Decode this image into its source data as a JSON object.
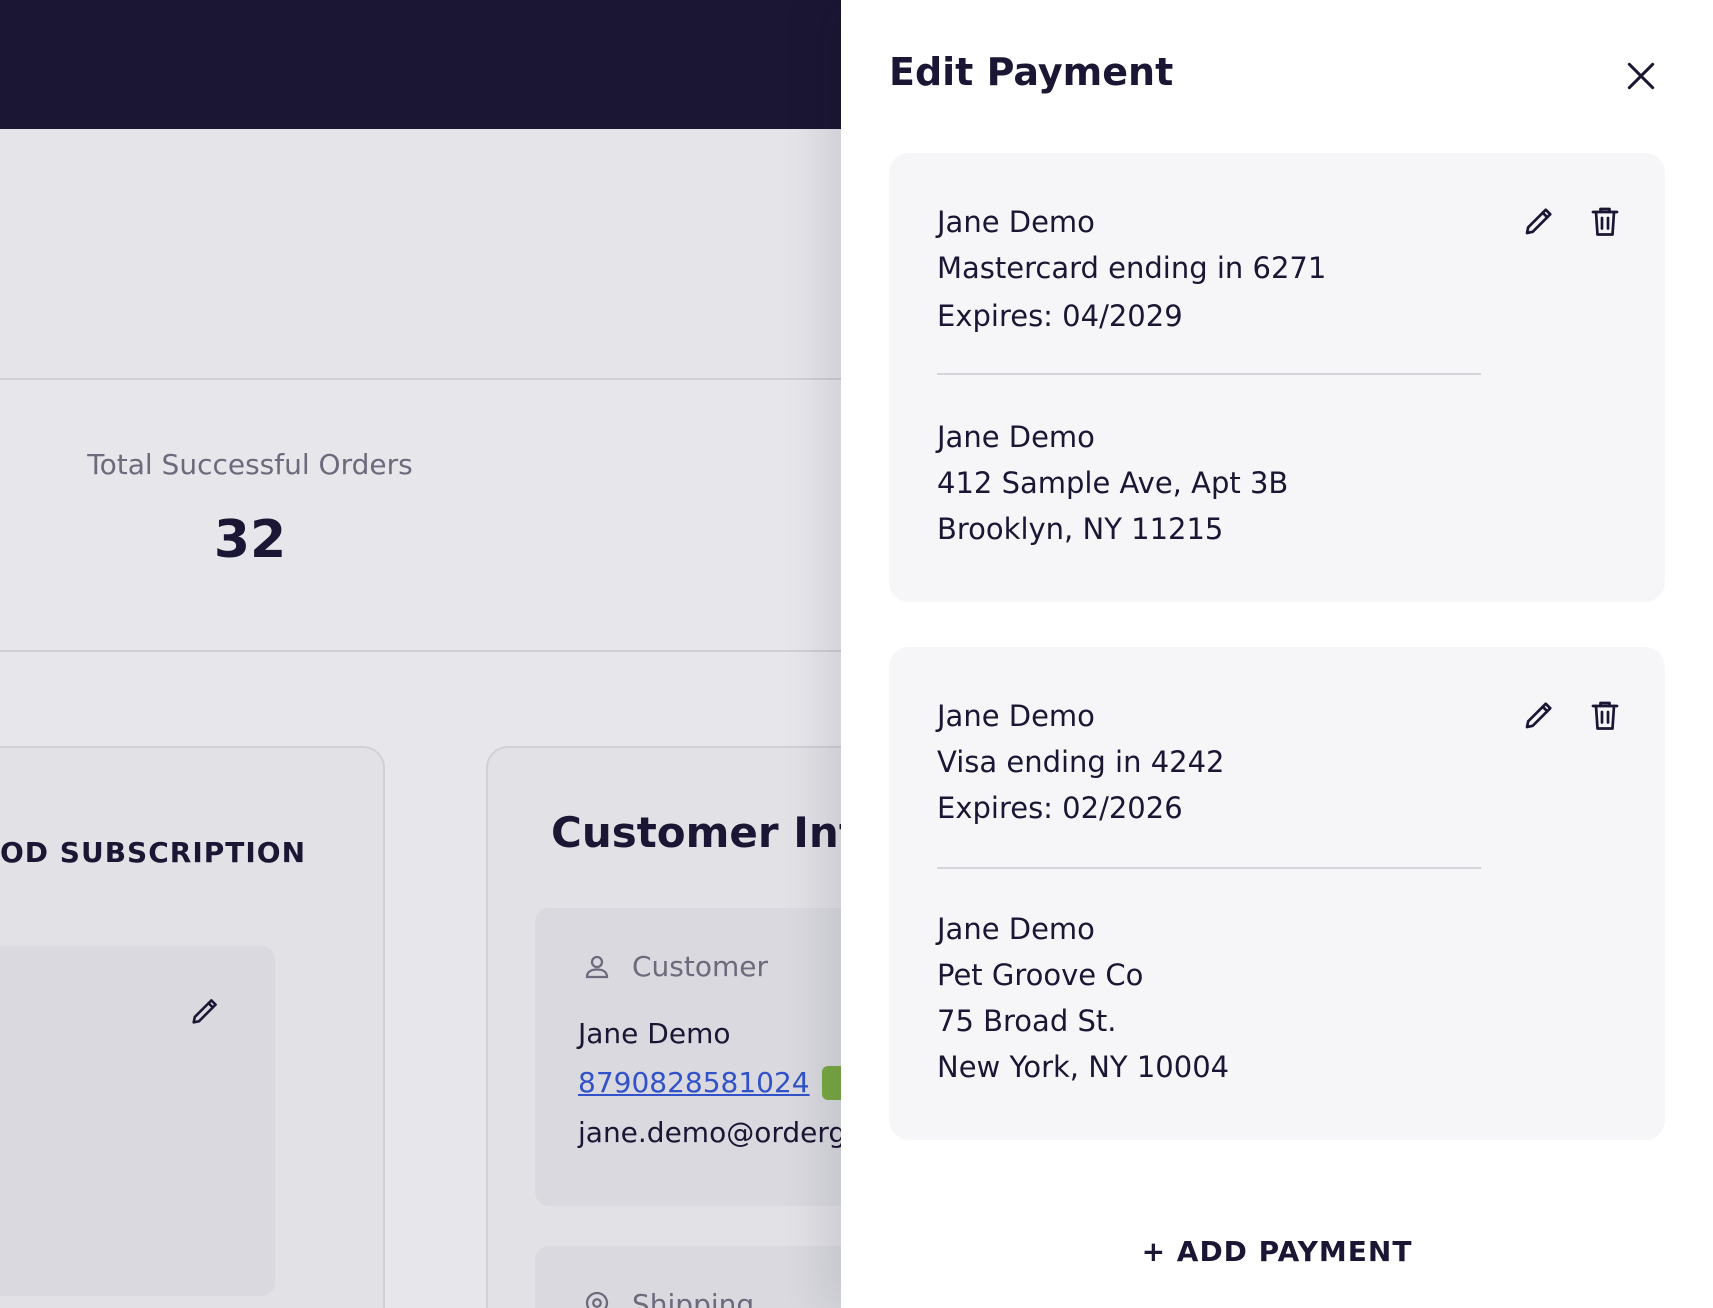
{
  "stats": {
    "total_orders_label": "Total Successful Orders",
    "total_orders_value": "32"
  },
  "subscription_card": {
    "title": "OD SUBSCRIPTION"
  },
  "customer_card": {
    "title": "Customer Info",
    "section_label": "Customer",
    "name": "Jane Demo",
    "phone": "8790828581024",
    "email": "jane.demo@ordergr",
    "shipping_label": "Shipping"
  },
  "drawer": {
    "title": "Edit Payment",
    "add_label": "+ ADD PAYMENT",
    "payments": [
      {
        "card_holder": "Jane Demo",
        "card_desc": "Mastercard ending in 6271",
        "expires": "Expires: 04/2029",
        "billing": [
          "Jane Demo",
          "412 Sample Ave, Apt 3B",
          "Brooklyn, NY 11215"
        ]
      },
      {
        "card_holder": "Jane Demo",
        "card_desc": "Visa ending in 4242",
        "expires": "Expires: 02/2026",
        "billing": [
          "Jane Demo",
          "Pet Groove Co",
          "75 Broad St.",
          "New York, NY 10004"
        ]
      }
    ]
  },
  "icons": {
    "close": "close-icon",
    "edit": "pencil-icon",
    "delete": "trash-icon",
    "customer": "person-icon",
    "shipping": "location-pin-icon",
    "copy": "copy-icon"
  },
  "colors": {
    "topbar": "#1a1633",
    "link": "#3152c8",
    "copy_badge": "#79a943",
    "drawer_bg": "#ffffff",
    "card_bg": "#f6f6f8"
  }
}
